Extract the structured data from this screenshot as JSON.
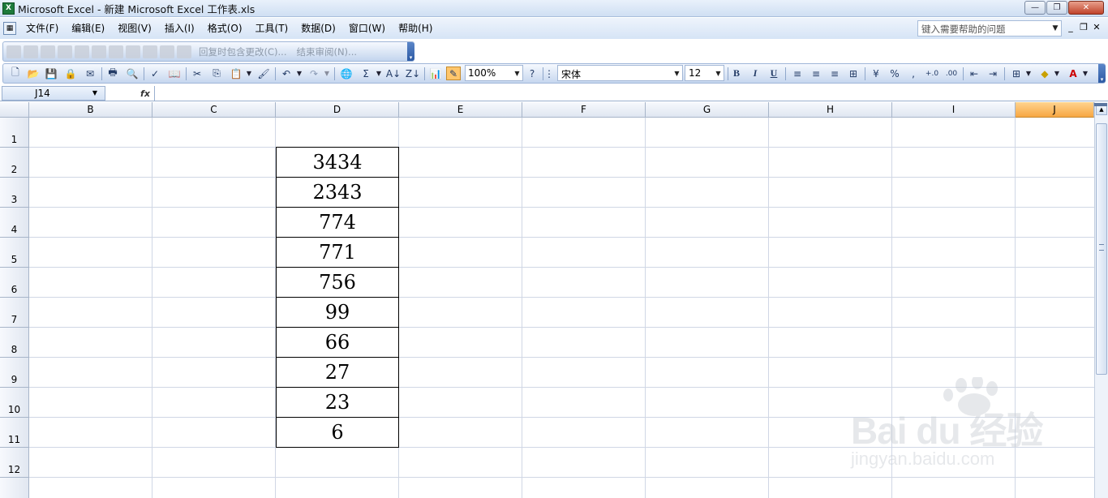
{
  "window": {
    "title": "Microsoft Excel - 新建 Microsoft Excel 工作表.xls",
    "app_icon": "excel-icon",
    "controls": [
      "minimize-icon",
      "restore-icon",
      "close-icon"
    ]
  },
  "menu": {
    "items": [
      "文件(F)",
      "编辑(E)",
      "视图(V)",
      "插入(I)",
      "格式(O)",
      "工具(T)",
      "数据(D)",
      "窗口(W)",
      "帮助(H)"
    ],
    "help_placeholder": "键入需要帮助的问题"
  },
  "review_toolbar": {
    "reply_label": "回复时包含更改(C)...",
    "end_review_label": "结束审阅(N)..."
  },
  "standard_toolbar": {
    "zoom": "100%",
    "font": "宋体",
    "font_size": "12",
    "bold": "B",
    "italic": "I",
    "underline": "U",
    "percent": "%",
    "comma": ",",
    "sum": "Σ"
  },
  "formula_bar": {
    "name_box": "J14",
    "fx": "fx",
    "formula": ""
  },
  "sheet": {
    "columns": [
      "B",
      "C",
      "D",
      "E",
      "F",
      "G",
      "H",
      "I",
      "J"
    ],
    "selected_column": "J",
    "rows": [
      "1",
      "2",
      "3",
      "4",
      "5",
      "6",
      "7",
      "8",
      "9",
      "10",
      "11",
      "12"
    ],
    "column_d_values": [
      "3434",
      "2343",
      "774",
      "771",
      "756",
      "99",
      "66",
      "27",
      "23",
      "6"
    ]
  },
  "accent_colors": {
    "selected_header": "#f7a743",
    "toolbar_blue": "#c6d7ef",
    "grid_line": "#d0d7e5"
  }
}
